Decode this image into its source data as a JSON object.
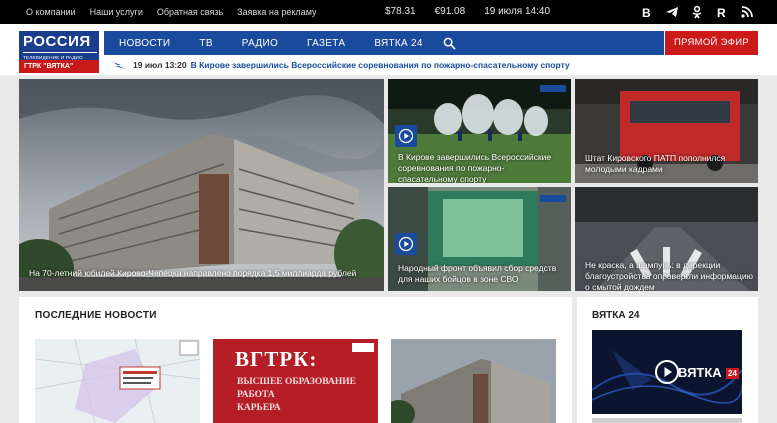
{
  "topbar": {
    "links": [
      "О компании",
      "Наши услуги",
      "Обратная связь",
      "Заявка на рекламу"
    ],
    "usd": "$78.31",
    "eur": "€91.08",
    "date": "19 июля 14:40",
    "social": [
      "vk-icon",
      "telegram-icon",
      "odnoklassniki-icon",
      "rutube-icon",
      "rss-icon"
    ]
  },
  "logo": {
    "line1": "РОССИЯ",
    "line2": "ТЕЛЕВИДЕНИЕ И РАДИО",
    "line3": "ГТРК \"ВЯТКА\""
  },
  "nav": {
    "items": [
      "НОВОСТИ",
      "ТВ",
      "РАДИО",
      "ГАЗЕТА",
      "ВЯТКА 24"
    ],
    "live": "ПРЯМОЙ ЭФИР"
  },
  "ticker": {
    "time": "19 июл 13:20",
    "text": "В Кирове завершились Всероссийские соревнования по пожарно-спасательному спорту"
  },
  "tiles": {
    "hero": "На 70-летний юбилей Кирово-Чепецка направлено порядка 1,5 миллиарда рублей",
    "t1": "В Кирове завершились Всероссийские соревнования по пожарно-спасательному спорту",
    "t2": "Штат Кировского ПАТП пополнился молодыми кадрами",
    "t3": "Народный фронт объявил сбор средств для наших бойцов в зоне СВО",
    "t4": "Не краска, а шампунь: в дирекции благоустройства опровергли информацию о смытой дождем"
  },
  "latest": {
    "title": "ПОСЛЕДНИЕ НОВОСТИ",
    "thumb2_line1": "ВГТРК:",
    "thumb2_line2": "ВЫСШЕЕ ОБРАЗОВАНИЕ",
    "thumb2_line3": "РАБОТА",
    "thumb2_line4": "КАРЬЕРА"
  },
  "vyatka24": {
    "title": "ВЯТКА 24",
    "logo_text": "ВЯТКА",
    "logo_num": "24"
  },
  "colors": {
    "nav_blue": "#1a4a9c",
    "live_red": "#cc1a1a",
    "logo_blue": "#1a3e8c"
  }
}
